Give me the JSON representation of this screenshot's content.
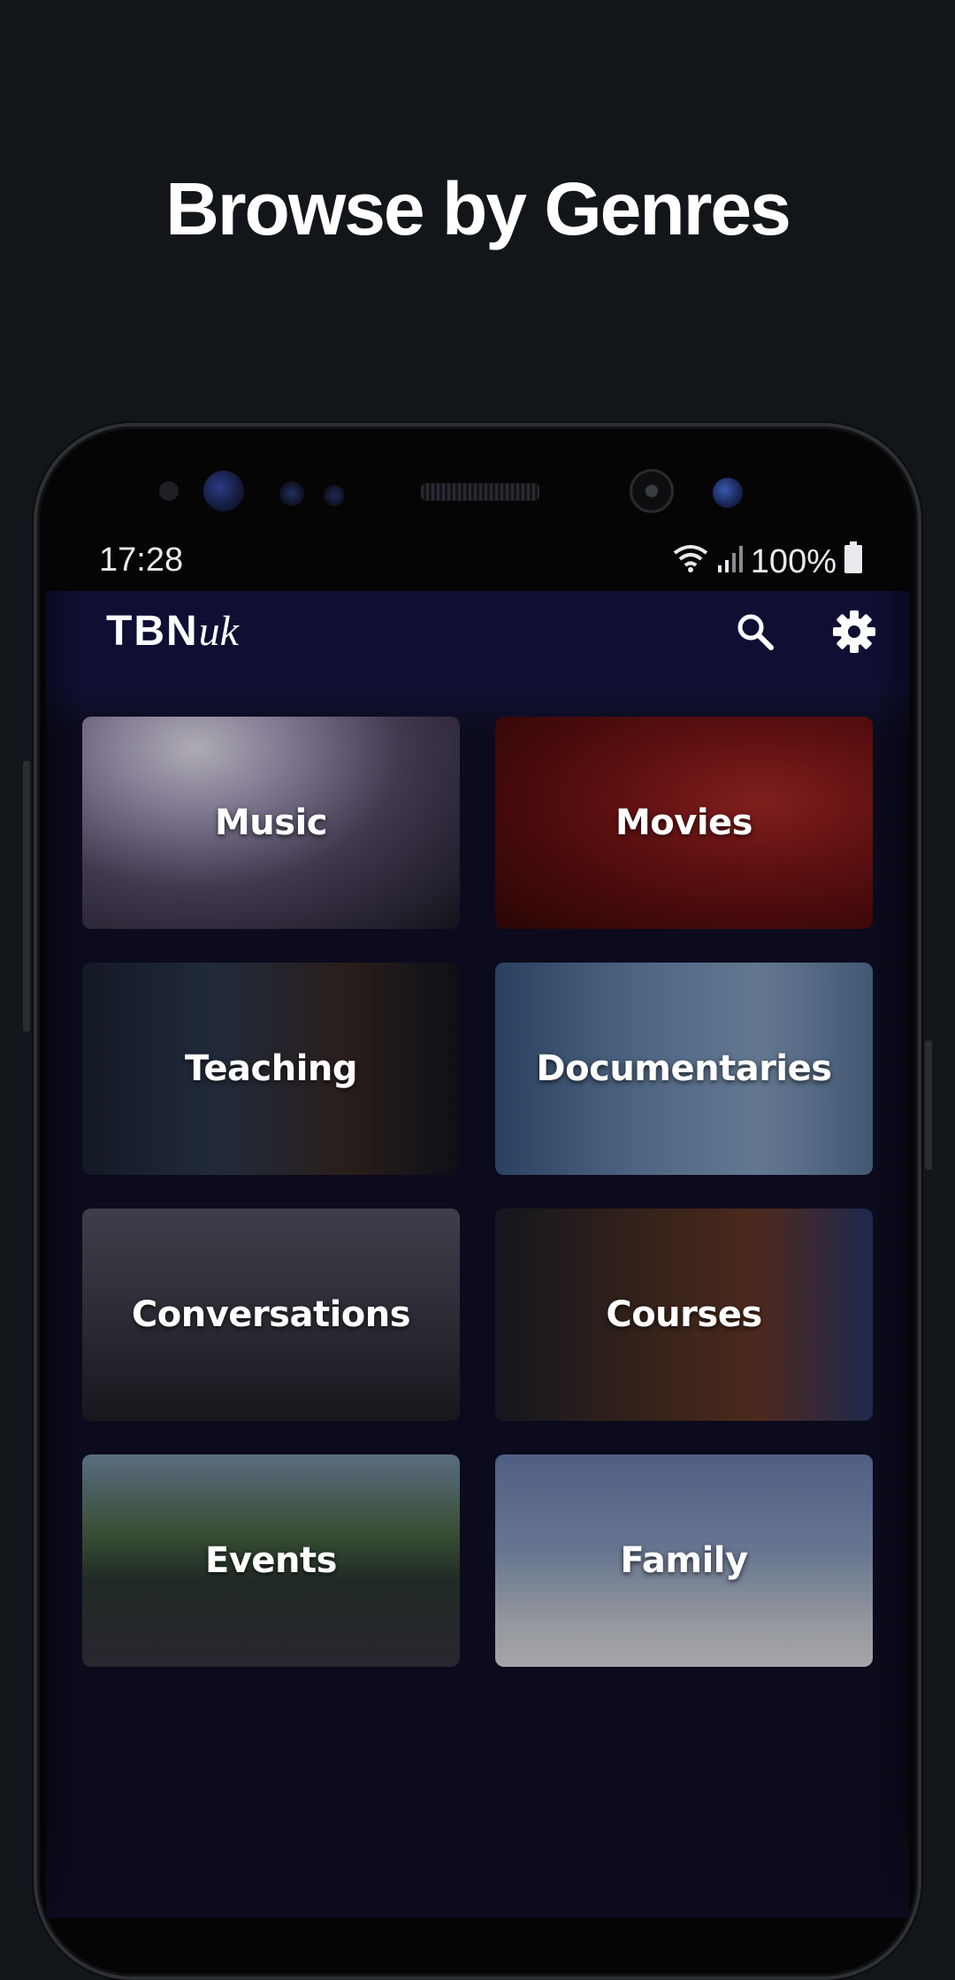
{
  "headline": "Browse by Genres",
  "status_bar": {
    "time": "17:28",
    "battery_percent": "100%",
    "icons": [
      "wifi-icon",
      "signal-icon",
      "battery-icon"
    ]
  },
  "app_bar": {
    "logo_main": "TBN",
    "logo_suffix": "uk",
    "actions": [
      "search-icon",
      "settings-icon"
    ]
  },
  "genres": [
    {
      "id": "music",
      "label": "Music"
    },
    {
      "id": "movies",
      "label": "Movies"
    },
    {
      "id": "teaching",
      "label": "Teaching"
    },
    {
      "id": "documentaries",
      "label": "Documentaries"
    },
    {
      "id": "conversations",
      "label": "Conversations"
    },
    {
      "id": "courses",
      "label": "Courses"
    },
    {
      "id": "events",
      "label": "Events"
    },
    {
      "id": "family",
      "label": "Family"
    }
  ],
  "colors": {
    "page_background": "#12161b",
    "screen_background": "#0b0b1d",
    "app_bar": "#0f0f34",
    "text": "#ffffff"
  }
}
